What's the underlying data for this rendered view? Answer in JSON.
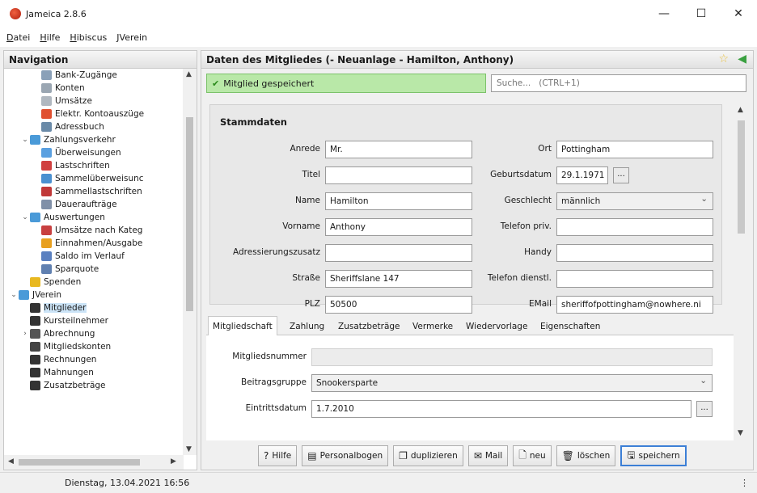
{
  "window": {
    "title": "Jameica 2.8.6",
    "controls": [
      "—",
      "☐",
      "✕"
    ]
  },
  "menu": [
    "Datei",
    "Hilfe",
    "Hibiscus",
    "JVerein"
  ],
  "navigation": {
    "title": "Navigation",
    "items": [
      {
        "label": "Bank-Zugänge",
        "indent": 2,
        "icon_color": "#8aa0b8"
      },
      {
        "label": "Konten",
        "indent": 2,
        "icon_color": "#9aa6b2"
      },
      {
        "label": "Umsätze",
        "indent": 2,
        "icon_color": "#b0b8c0"
      },
      {
        "label": "Elektr. Kontoauszüge",
        "indent": 2,
        "icon_color": "#e05030"
      },
      {
        "label": "Adressbuch",
        "indent": 2,
        "icon_color": "#6a8aa8"
      },
      {
        "label": "Zahlungsverkehr",
        "indent": 1,
        "icon_color": "#4a9ad8",
        "toggle": "⌄"
      },
      {
        "label": "Überweisungen",
        "indent": 2,
        "icon_color": "#5aa0e0"
      },
      {
        "label": "Lastschriften",
        "indent": 2,
        "icon_color": "#d04040"
      },
      {
        "label": "Sammelüberweisunc",
        "indent": 2,
        "icon_color": "#4a90d0"
      },
      {
        "label": "Sammellastschriften",
        "indent": 2,
        "icon_color": "#c03838"
      },
      {
        "label": "Daueraufträge",
        "indent": 2,
        "icon_color": "#8090a8"
      },
      {
        "label": "Auswertungen",
        "indent": 1,
        "icon_color": "#4a9ad8",
        "toggle": "⌄"
      },
      {
        "label": "Umsätze nach Kateg",
        "indent": 2,
        "icon_color": "#c84040"
      },
      {
        "label": "Einnahmen/Ausgabe",
        "indent": 2,
        "icon_color": "#e8a020"
      },
      {
        "label": "Saldo im Verlauf",
        "indent": 2,
        "icon_color": "#5a80c0"
      },
      {
        "label": "Sparquote",
        "indent": 2,
        "icon_color": "#6080b0"
      },
      {
        "label": "Spenden",
        "indent": 1,
        "icon_color": "#e8b820"
      },
      {
        "label": "JVerein",
        "indent": 0,
        "icon_color": "#4a9ad8",
        "toggle": "⌄"
      },
      {
        "label": "Mitglieder",
        "indent": 1,
        "icon_color": "#333333",
        "selected": true
      },
      {
        "label": "Kursteilnehmer",
        "indent": 1,
        "icon_color": "#333333"
      },
      {
        "label": "Abrechnung",
        "indent": 1,
        "icon_color": "#555555",
        "toggle": "›"
      },
      {
        "label": "Mitgliedskonten",
        "indent": 1,
        "icon_color": "#444444"
      },
      {
        "label": "Rechnungen",
        "indent": 1,
        "icon_color": "#333333"
      },
      {
        "label": "Mahnungen",
        "indent": 1,
        "icon_color": "#333333"
      },
      {
        "label": "Zusatzbeträge",
        "indent": 1,
        "icon_color": "#333333"
      }
    ]
  },
  "main": {
    "title": "Daten des Mitgliedes (- Neuanlage - Hamilton, Anthony)",
    "status_message": "Mitglied gespeichert",
    "search_placeholder": "Suche...   (CTRL+1)",
    "stammdaten": {
      "heading": "Stammdaten",
      "left": [
        {
          "label": "Anrede",
          "value": "Mr."
        },
        {
          "label": "Titel",
          "value": ""
        },
        {
          "label": "Name",
          "value": "Hamilton"
        },
        {
          "label": "Vorname",
          "value": "Anthony"
        },
        {
          "label": "Adressierungszusatz",
          "value": ""
        },
        {
          "label": "Straße",
          "value": "Sheriffslane 147"
        },
        {
          "label": "PLZ",
          "value": "50500"
        }
      ],
      "right": [
        {
          "label": "Ort",
          "value": "Pottingham"
        },
        {
          "label": "Geburtsdatum",
          "value": "29.1.1971"
        },
        {
          "label": "Geschlecht",
          "value": "männlich"
        },
        {
          "label": "Telefon priv.",
          "value": ""
        },
        {
          "label": "Handy",
          "value": ""
        },
        {
          "label": "Telefon dienstl.",
          "value": ""
        },
        {
          "label": "EMail",
          "value": "sheriffofpottingham@nowhere.ni"
        }
      ],
      "date_button": "..."
    },
    "tabs": [
      "Mitgliedschaft",
      "Zahlung",
      "Zusatzbeträge",
      "Vermerke",
      "Wiedervorlage",
      "Eigenschaften"
    ],
    "mitgliedschaft": {
      "mitgliedsnummer_label": "Mitgliedsnummer",
      "mitgliedsnummer_value": "",
      "beitragsgruppe_label": "Beitragsgruppe",
      "beitragsgruppe_value": "Snookersparte",
      "eintrittsdatum_label": "Eintrittsdatum",
      "eintrittsdatum_value": "1.7.2010"
    },
    "buttons": [
      {
        "label": "Hilfe",
        "icon": "?"
      },
      {
        "label": "Personalbogen",
        "icon": "▤"
      },
      {
        "label": "duplizieren",
        "icon": "❐"
      },
      {
        "label": "Mail",
        "icon": "✉"
      },
      {
        "label": "neu",
        "icon": "🗋"
      },
      {
        "label": "löschen",
        "icon": "🗑"
      },
      {
        "label": "speichern",
        "icon": "🖫",
        "primary": true
      }
    ]
  },
  "statusbar": {
    "text": "Dienstag, 13.04.2021 16:56",
    "right": "⋮"
  },
  "colors": {
    "success": "#b9e8a8",
    "selection": "#cce4f7",
    "primary_border": "#3c7fd6"
  }
}
